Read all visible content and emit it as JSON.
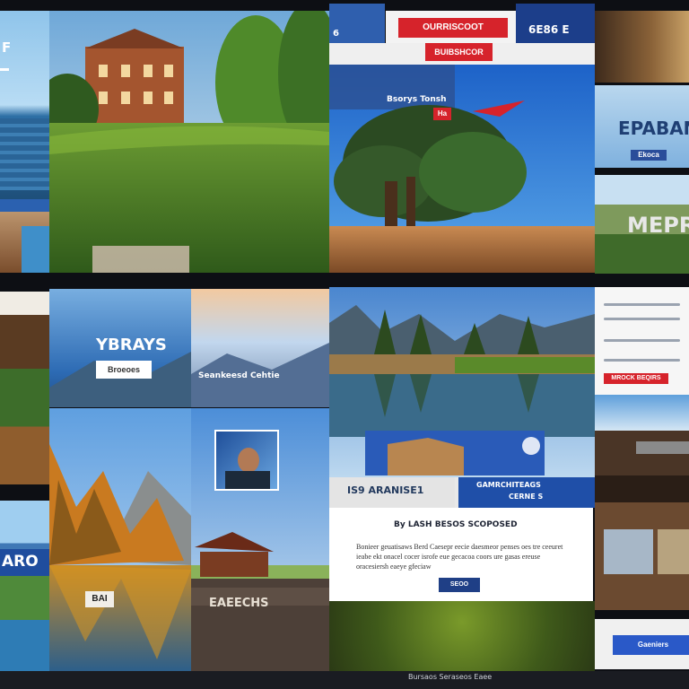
{
  "collage": {
    "left_strip": {
      "badge": "F",
      "bottom_label": "ARO"
    },
    "hero_scenes": {
      "hotel": "hotel on green lawn"
    },
    "top_center": {
      "banner_red_a": "OURRISCOOT",
      "banner_blue": "6E86 E",
      "banner_red_b": "BUIBSHCOR",
      "tree_panel_caption": "Bsorys Tonsh",
      "tree_panel_badge": "Ha"
    },
    "right_column": {
      "top_panel_title": "EPABAN",
      "top_panel_button": "Ekoca",
      "mid_panel_title": "MEPR",
      "text_panel_button": "MROCK BEQIRS"
    },
    "middle_left": {
      "card_title": "YBRAYS",
      "card_button": "Broeoes",
      "side_caption": "Seankeesd Cehtie"
    },
    "lake_panel": {
      "info_left": "IS9 ARANISE1",
      "info_right": "GAMRCHITEAGS",
      "info_right_sub": "CERNE S",
      "description_title": "By LASH BESOS SCOPOSED",
      "description_text": "Bonieer geuatisaws Berd Caesepr eecie daesmeor penses oes tre ceeuret ieabe ekt onacel cocer isrofe eue gecacoa coors ure gasas ereuse oracesiersh eaeye gfeciaw",
      "description_button": "SEOO"
    },
    "bottom_left": {
      "small_badge": "BAI",
      "cabin_caption": "EAEECHS"
    },
    "bottom_right": {
      "button": "Gaeniers"
    },
    "footer_caption": "Bursaos Seraseos   Eaee"
  }
}
